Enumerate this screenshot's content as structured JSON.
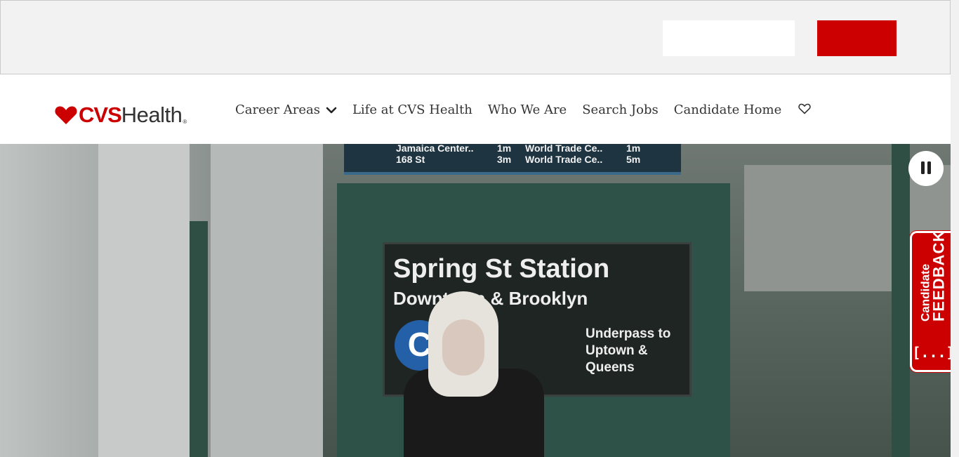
{
  "brand": {
    "logo_cvs": "CVS",
    "logo_health": "Health",
    "logo_reg": "®",
    "accent_color": "#cc0000"
  },
  "nav": {
    "items": [
      {
        "label": "Career Areas",
        "has_dropdown": true
      },
      {
        "label": "Life at CVS Health"
      },
      {
        "label": "Who We Are"
      },
      {
        "label": "Search Jobs"
      },
      {
        "label": "Candidate Home"
      }
    ],
    "saved_jobs_icon": "heart-icon"
  },
  "hero": {
    "sign_title": "Spring St Station",
    "sign_subtitle": "Downtown & Brooklyn",
    "sign_line": "C",
    "sign_note": [
      "Underpass to",
      "Uptown &",
      "Queens"
    ],
    "board_row1_left": "Jamaica Center..",
    "board_row1_mid": "1m",
    "board_row1_right": "World Trade Ce..",
    "board_row1_end": "1m",
    "board_row2_left": "168 St",
    "board_row2_mid": "3m",
    "board_row2_right": "World Trade Ce..",
    "board_row2_end": "5m",
    "video_control_icon": "pause-icon"
  },
  "feedback": {
    "line1": "Candidate",
    "line2": "FEEDBACK",
    "icon": "[...]"
  }
}
